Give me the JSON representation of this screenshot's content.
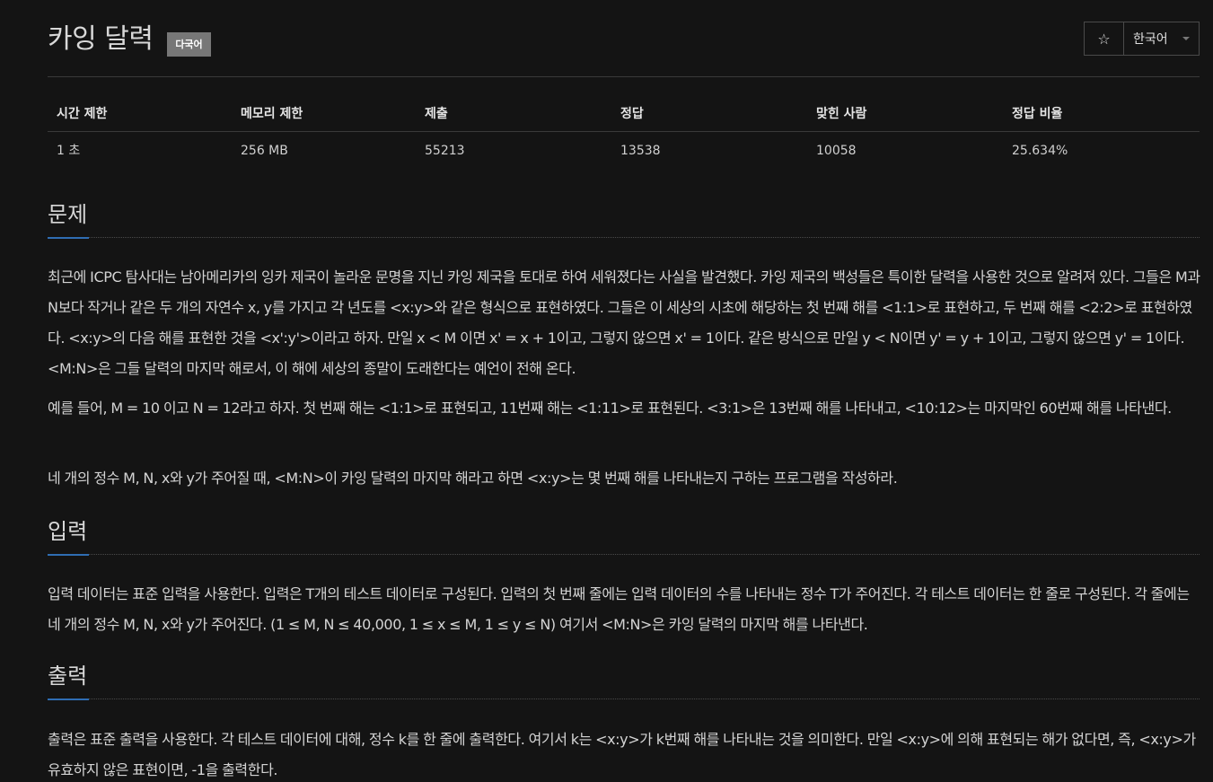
{
  "header": {
    "title": "카잉 달력",
    "badge": "다국어",
    "star_icon": "☆",
    "language": "한국어"
  },
  "stats": {
    "headers": [
      "시간 제한",
      "메모리 제한",
      "제출",
      "정답",
      "맞힌 사람",
      "정답 비율"
    ],
    "values": [
      "1 초",
      "256 MB",
      "55213",
      "13538",
      "10058",
      "25.634%"
    ]
  },
  "sections": {
    "problem": {
      "title": "문제",
      "paragraphs": [
        "최근에 ICPC 탐사대는 남아메리카의 잉카 제국이 놀라운 문명을 지닌 카잉 제국을 토대로 하여 세워졌다는 사실을 발견했다. 카잉 제국의 백성들은 특이한 달력을 사용한 것으로 알려져 있다. 그들은 M과 N보다 작거나 같은 두 개의 자연수 x, y를 가지고 각 년도를 <x:y>와 같은 형식으로 표현하였다. 그들은 이 세상의 시초에 해당하는 첫 번째 해를 <1:1>로 표현하고, 두 번째 해를 <2:2>로 표현하였다. <x:y>의 다음 해를 표현한 것을 <x':y'>이라고 하자. 만일 x < M 이면 x' = x + 1이고, 그렇지 않으면 x' = 1이다. 같은 방식으로 만일 y < N이면 y' = y + 1이고, 그렇지 않으면 y' = 1이다. <M:N>은 그들 달력의 마지막 해로서, 이 해에 세상의 종말이 도래한다는 예언이 전해 온다.",
        "예를 들어, M = 10 이고 N = 12라고 하자. 첫 번째 해는 <1:1>로 표현되고, 11번째 해는 <1:11>로 표현된다. <3:1>은 13번째 해를 나타내고, <10:12>는 마지막인 60번째 해를 나타낸다.",
        "네 개의 정수 M, N, x와 y가 주어질 때, <M:N>이 카잉 달력의 마지막 해라고 하면 <x:y>는 몇 번째 해를 나타내는지 구하는 프로그램을 작성하라."
      ]
    },
    "input": {
      "title": "입력",
      "paragraphs": [
        "입력 데이터는 표준 입력을 사용한다. 입력은 T개의 테스트 데이터로 구성된다. 입력의 첫 번째 줄에는 입력 데이터의 수를 나타내는 정수 T가 주어진다. 각 테스트 데이터는 한 줄로 구성된다. 각 줄에는 네 개의 정수 M, N, x와 y가 주어진다. (1 ≤ M, N ≤ 40,000, 1 ≤ x ≤ M, 1 ≤ y ≤ N) 여기서 <M:N>은 카잉 달력의 마지막 해를 나타낸다."
      ]
    },
    "output": {
      "title": "출력",
      "paragraphs": [
        "출력은 표준 출력을 사용한다. 각 테스트 데이터에 대해, 정수 k를 한 줄에 출력한다. 여기서 k는 <x:y>가 k번째 해를 나타내는 것을 의미한다. 만일 <x:y>에 의해 표현되는 해가 없다면, 즉, <x:y>가 유효하지 않은 표현이면, -1을 출력한다."
      ]
    }
  }
}
